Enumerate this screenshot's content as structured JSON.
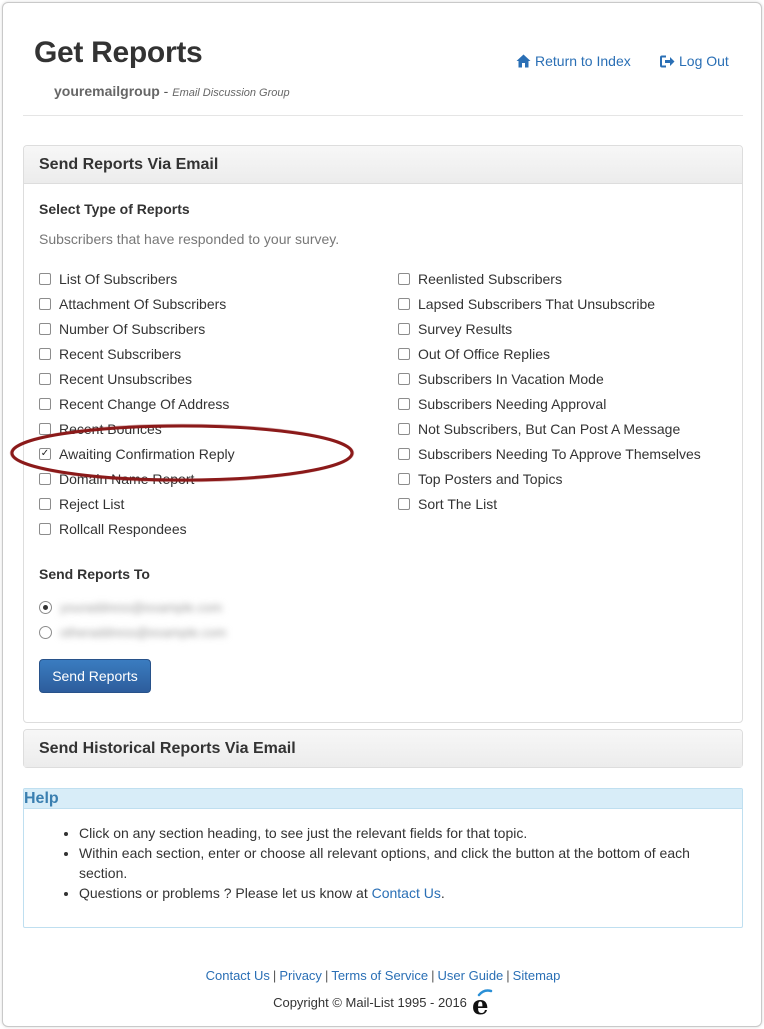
{
  "header": {
    "title": "Get Reports",
    "group_name": "youremailgroup",
    "group_desc": "Email Discussion Group",
    "return_label": "Return to Index",
    "logout_label": "Log Out"
  },
  "send_panel": {
    "heading": "Send Reports Via Email",
    "type_label": "Select Type of Reports",
    "description": "Subscribers that have responded to your survey.",
    "left_options": [
      {
        "label": "List Of Subscribers",
        "checked": false
      },
      {
        "label": "Attachment Of Subscribers",
        "checked": false
      },
      {
        "label": "Number Of Subscribers",
        "checked": false
      },
      {
        "label": "Recent Subscribers",
        "checked": false
      },
      {
        "label": "Recent Unsubscribes",
        "checked": false
      },
      {
        "label": "Recent Change Of Address",
        "checked": false
      },
      {
        "label": "Recent Bounces",
        "checked": false
      },
      {
        "label": "Awaiting Confirmation Reply",
        "checked": true
      },
      {
        "label": "Domain Name Report",
        "checked": false
      },
      {
        "label": "Reject List",
        "checked": false
      },
      {
        "label": "Rollcall Respondees",
        "checked": false
      }
    ],
    "right_options": [
      {
        "label": "Reenlisted Subscribers",
        "checked": false
      },
      {
        "label": "Lapsed Subscribers That Unsubscribe",
        "checked": false
      },
      {
        "label": "Survey Results",
        "checked": false
      },
      {
        "label": "Out Of Office Replies",
        "checked": false
      },
      {
        "label": "Subscribers In Vacation Mode",
        "checked": false
      },
      {
        "label": "Subscribers Needing Approval",
        "checked": false
      },
      {
        "label": "Not Subscribers, But Can Post A Message",
        "checked": false
      },
      {
        "label": "Subscribers Needing To Approve Themselves",
        "checked": false
      },
      {
        "label": "Top Posters and Topics",
        "checked": false
      },
      {
        "label": "Sort The List",
        "checked": false
      }
    ],
    "send_to_label": "Send Reports To",
    "recipients": [
      {
        "email": "youraddress@example.com",
        "selected": true
      },
      {
        "email": "otheraddress@example.com",
        "selected": false
      }
    ],
    "button_label": "Send Reports"
  },
  "historical_panel": {
    "heading": "Send Historical Reports Via Email"
  },
  "help": {
    "heading": "Help",
    "item1": "Click on any section heading, to see just the relevant fields for that topic.",
    "item2": "Within each section, enter or choose all relevant options, and click the button at the bottom of each section.",
    "item3_prefix": "Questions or problems ? Please let us know at ",
    "item3_link": "Contact Us",
    "item3_suffix": "."
  },
  "footer": {
    "links": [
      "Contact Us",
      "Privacy",
      "Terms of Service",
      "User Guide",
      "Sitemap"
    ],
    "copyright": "Copyright © Mail-List 1995 - 2016"
  },
  "colors": {
    "link": "#2a6fb5",
    "button": "#2d5d9c",
    "annotation": "#8b1a1a",
    "help_header": "#d8edf8"
  }
}
